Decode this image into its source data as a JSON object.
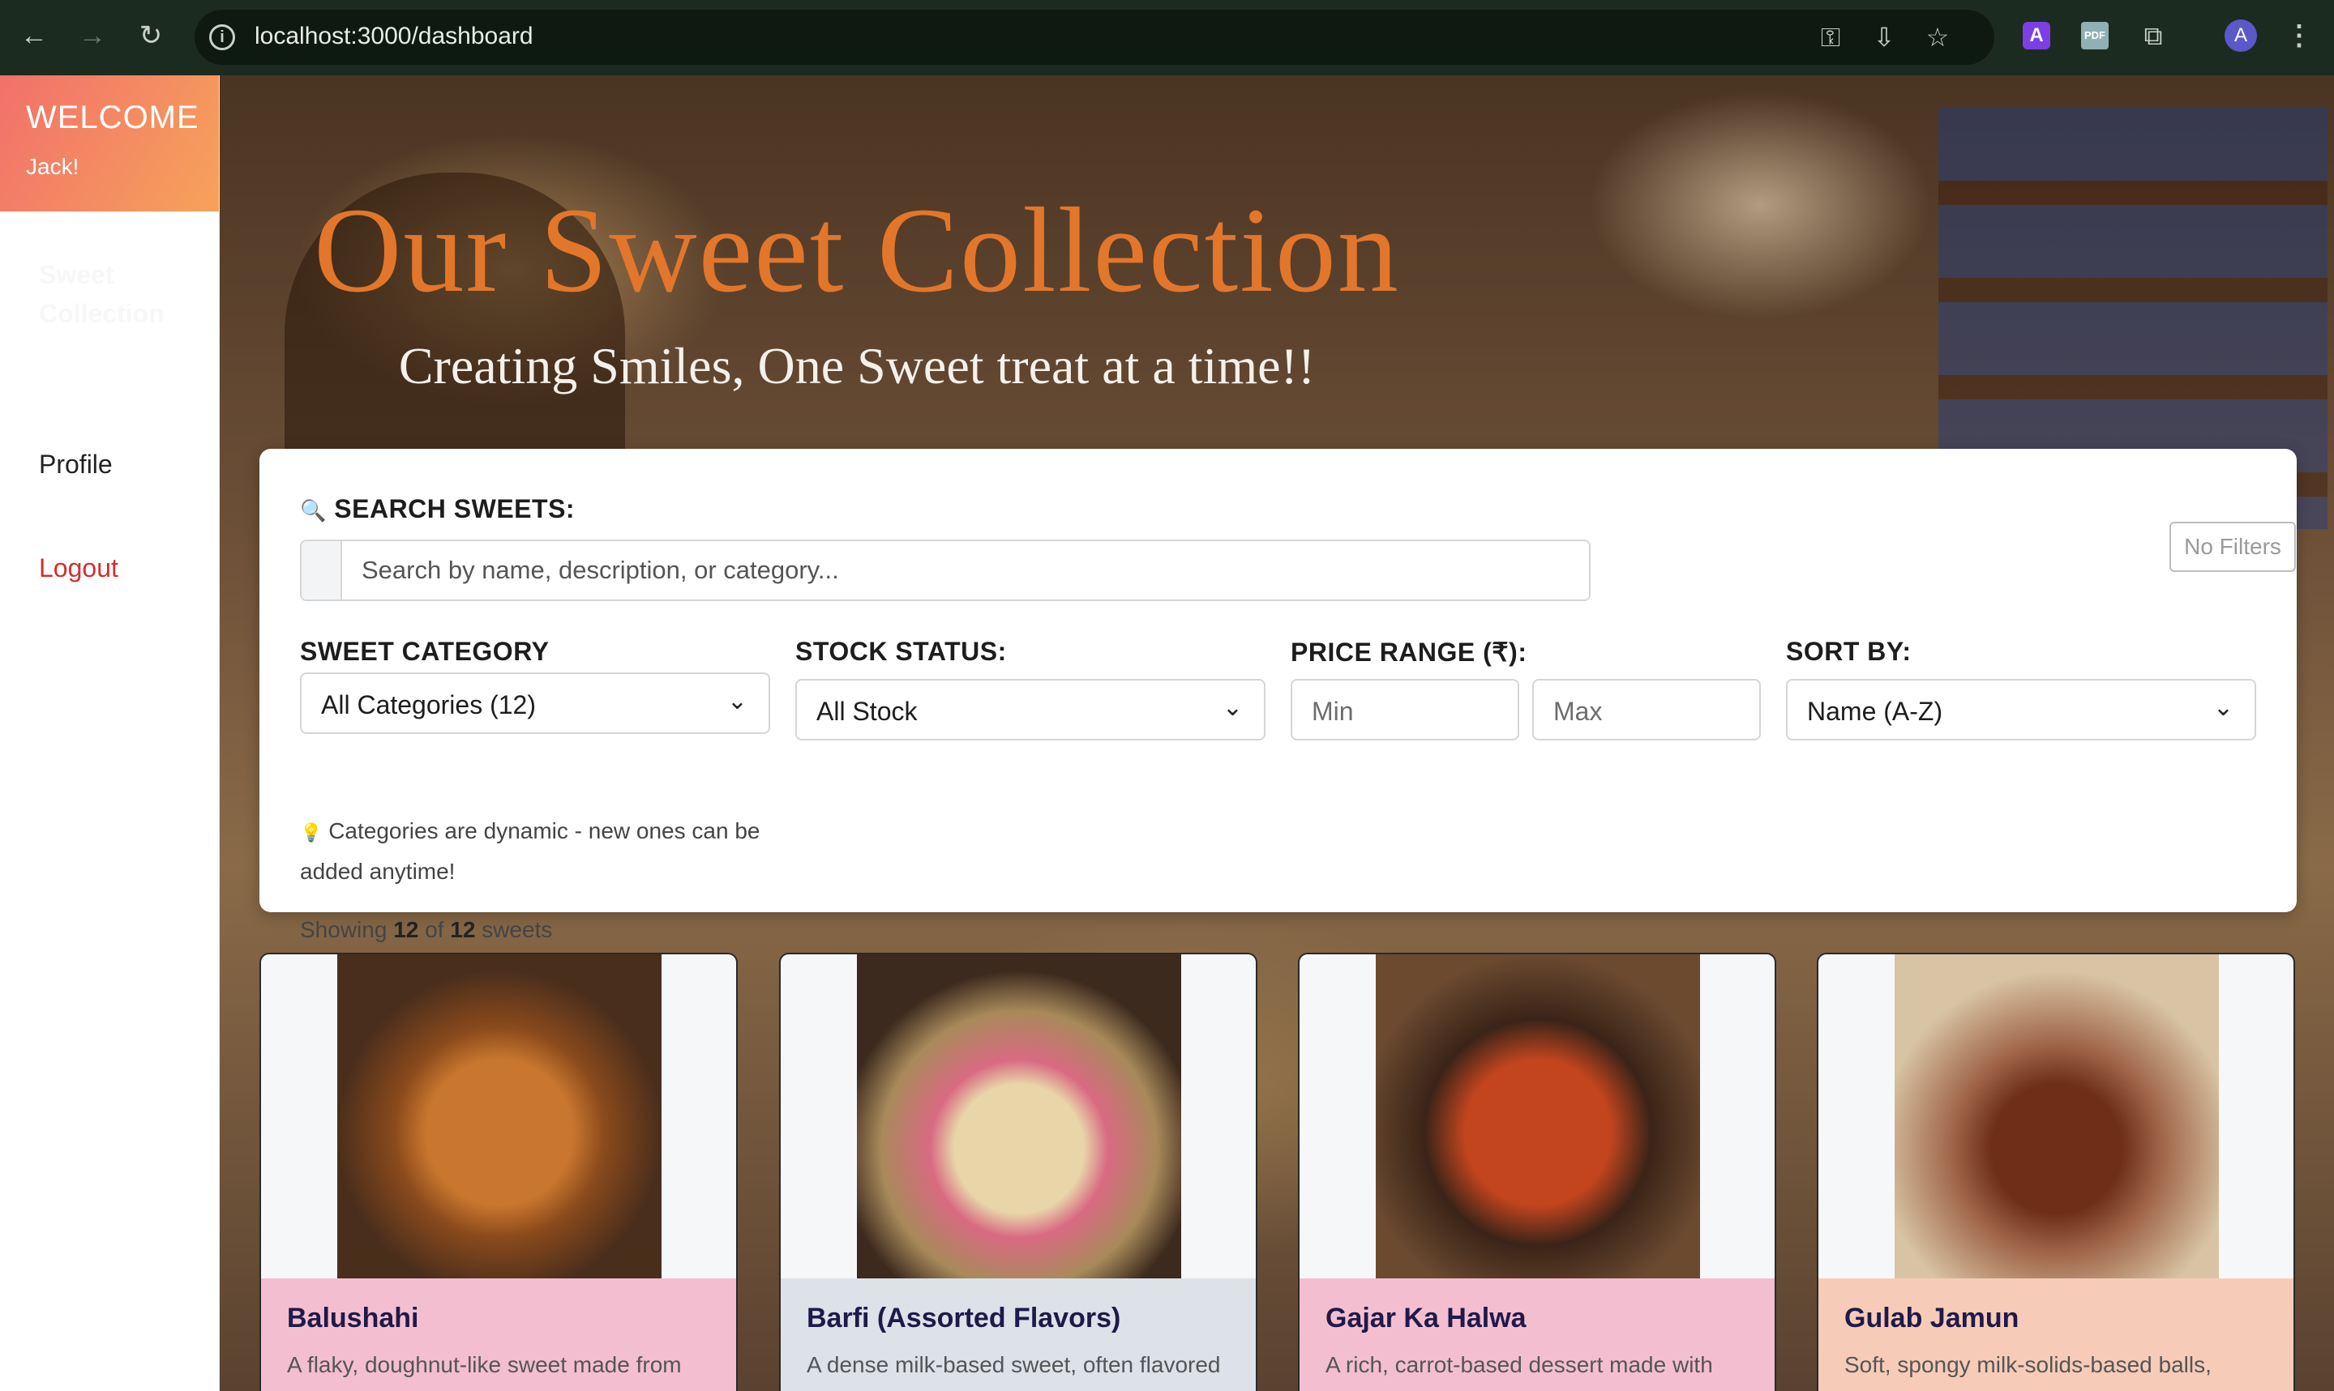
{
  "browser": {
    "url": "localhost:3000/dashboard",
    "profile_initial": "A"
  },
  "sidebar": {
    "welcome_title": "WELCOME",
    "welcome_user": "Jack!",
    "items": [
      {
        "label": "Sweet Collection"
      },
      {
        "label": "Profile"
      },
      {
        "label": "Logout"
      }
    ]
  },
  "hero": {
    "title": "Our Sweet Collection",
    "subtitle": "Creating Smiles, One Sweet treat at a time!!"
  },
  "filters": {
    "search_label": "SEARCH SWEETS:",
    "search_placeholder": "Search by name, description, or category...",
    "no_filters": "No Filters",
    "category_label": "SWEET CATEGORY",
    "category_value": "All Categories (12)",
    "category_hint": "Categories are dynamic - new ones can be added anytime!",
    "stock_label": "STOCK STATUS:",
    "stock_value": "All Stock",
    "price_label": "PRICE RANGE (₹):",
    "price_min_placeholder": "Min",
    "price_max_placeholder": "Max",
    "sort_label": "SORT BY:",
    "sort_value": "Name (A-Z)",
    "showing_prefix": "Showing",
    "showing_count": "12",
    "showing_of": "of",
    "showing_total": "12",
    "showing_suffix": "sweets"
  },
  "cards": [
    {
      "name": "Balushahi",
      "description": "A flaky, doughnut-like sweet made from",
      "color": "#f3bfd0"
    },
    {
      "name": "Barfi (Assorted Flavors)",
      "description": "A dense milk-based sweet, often flavored",
      "color": "#dde1e8"
    },
    {
      "name": "Gajar Ka Halwa",
      "description": "A rich, carrot-based dessert made with",
      "color": "#f3bfd0"
    },
    {
      "name": "Gulab Jamun",
      "description": "Soft, spongy milk-solids-based balls,",
      "color": "#f6ccb8"
    }
  ]
}
